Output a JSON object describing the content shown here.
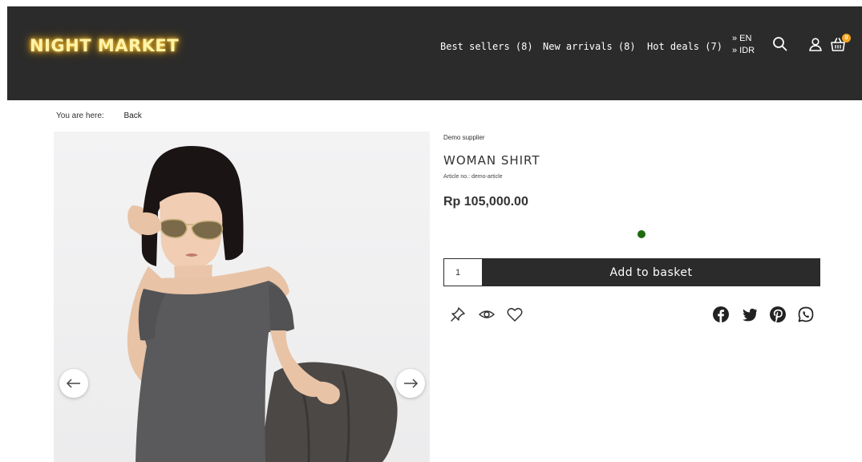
{
  "header": {
    "logo": "NIGHT MARKET",
    "nav": [
      {
        "label": "Best sellers (8)"
      },
      {
        "label": "New arrivals (8)"
      },
      {
        "label": "Hot deals (7)"
      }
    ],
    "lang": "» EN",
    "currency": "» IDR",
    "cart_count": "0",
    "icons": [
      "search-icon",
      "user-icon",
      "cart-icon"
    ]
  },
  "breadcrumb": {
    "label": "You are here:",
    "back": "Back"
  },
  "product": {
    "supplier": "Demo supplier",
    "title": "WOMAN SHIRT",
    "article": "Article no.: demo-article",
    "price": "Rp 105,000.00",
    "quantity": "1",
    "add_to_basket": "Add to basket",
    "variant_color": "#1e6b10"
  },
  "colors": {
    "header_bg": "#2b2b2b",
    "logo_glow": "#f3c63f",
    "badge": "#f5a524"
  }
}
